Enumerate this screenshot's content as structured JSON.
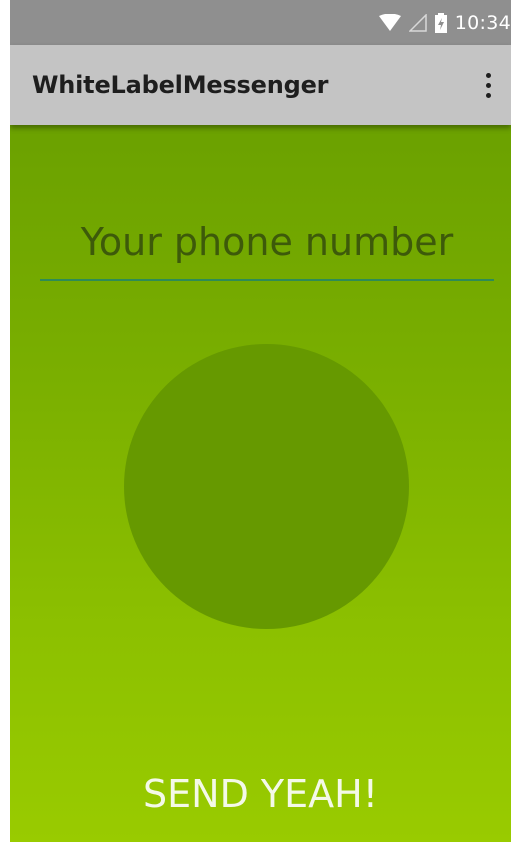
{
  "status_bar": {
    "time": "10:34",
    "icons": [
      "wifi-icon",
      "signal-icon",
      "battery-charging-icon"
    ]
  },
  "app_bar": {
    "title": "WhiteLabelMessenger",
    "overflow_icon": "more-vert-icon"
  },
  "main": {
    "phone_input": {
      "placeholder": "Your phone number",
      "value": ""
    },
    "send_button": {
      "label": "SEND YEAH!"
    }
  },
  "colors": {
    "status_bar": "#8f8f8f",
    "app_bar": "#c4c4c4",
    "gradient_top": "#6ba100",
    "gradient_bottom": "#99cb00",
    "circle": "#669900",
    "input_underline": "#2e8b57"
  }
}
